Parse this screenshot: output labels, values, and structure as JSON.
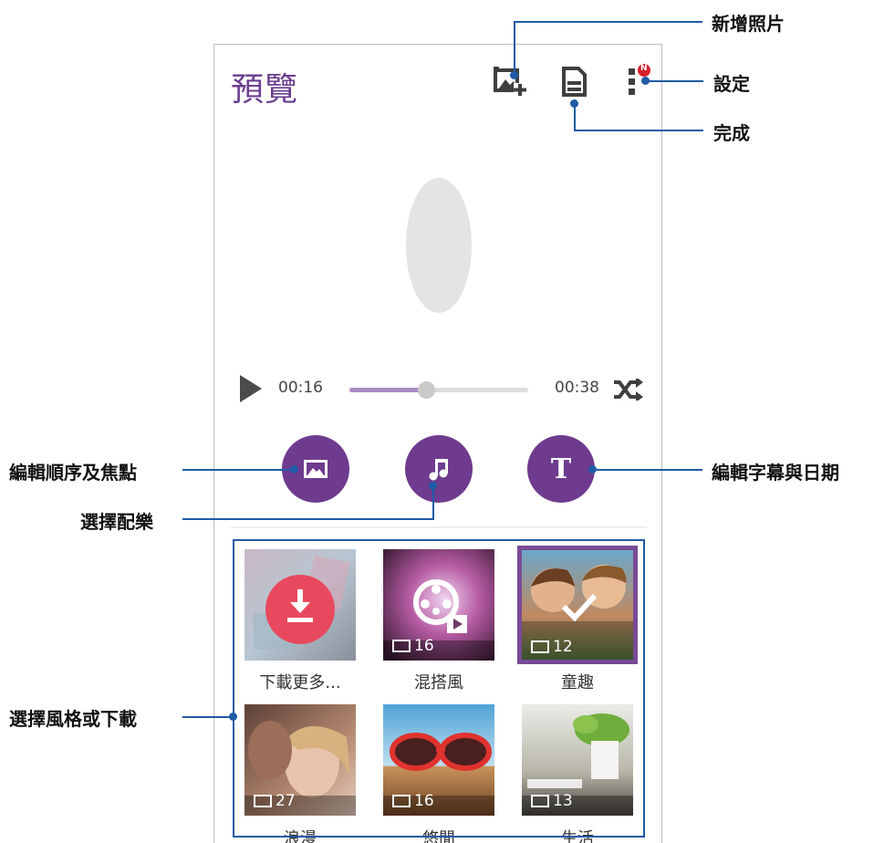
{
  "app": {
    "title": "預覽"
  },
  "toolbar": {
    "add_photo_icon": "add-photo-icon",
    "done_icon": "save-icon",
    "settings_icon": "more-vert-icon",
    "notification_badge": "N"
  },
  "player": {
    "current_time": "00:16",
    "total_time": "00:38",
    "progress": 0.43
  },
  "actions": {
    "edit_order_icon": "image-icon",
    "music_icon": "music-note-icon",
    "text_icon_label": "T"
  },
  "styles": [
    {
      "label": "下載更多...",
      "count": "",
      "kind": "download"
    },
    {
      "label": "混搭風",
      "count": "16",
      "kind": "mix"
    },
    {
      "label": "童趣",
      "count": "12",
      "kind": "kids",
      "selected": true
    },
    {
      "label": "浪漫",
      "count": "27",
      "kind": "romance"
    },
    {
      "label": "悠閒",
      "count": "16",
      "kind": "leisure"
    },
    {
      "label": "生活",
      "count": "13",
      "kind": "life"
    }
  ],
  "callouts": {
    "add_photo": "新增照片",
    "settings": "設定",
    "done": "完成",
    "edit_order": "編輯順序及焦點",
    "select_music": "選擇配樂",
    "edit_text": "編輯字幕與日期",
    "select_style": "選擇風格或下載"
  },
  "colors": {
    "accent": "#6e3b8e",
    "download": "#e8495e",
    "callout_line": "#1f5aa6"
  }
}
